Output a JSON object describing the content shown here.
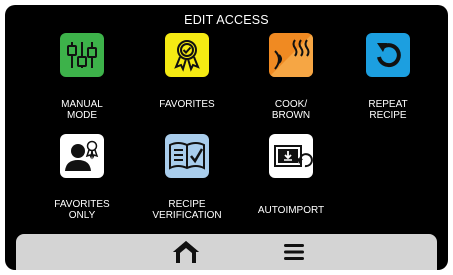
{
  "screen": {
    "title": "EDIT ACCESS"
  },
  "tiles": [
    {
      "label_line1": "MANUAL",
      "label_line2": "MODE",
      "color": "#3db24a"
    },
    {
      "label_line1": "FAVORITES",
      "label_line2": "",
      "color": "#f5ea13"
    },
    {
      "label_line1": "COOK/",
      "label_line2": "BROWN",
      "color": "#f08a22"
    },
    {
      "label_line1": "REPEAT",
      "label_line2": "RECIPE",
      "color": "#1c9fe0"
    },
    {
      "label_line1": "FAVORITES",
      "label_line2": "ONLY",
      "color": "#ffffff"
    },
    {
      "label_line1": "RECIPE",
      "label_line2": "VERIFICATION",
      "color": "#a9cdec"
    },
    {
      "label_line1": "AUTOIMPORT",
      "label_line2": "",
      "color": "#ffffff"
    }
  ],
  "nav": {
    "home_icon": "home-icon",
    "menu_icon": "hamburger-menu-icon"
  }
}
